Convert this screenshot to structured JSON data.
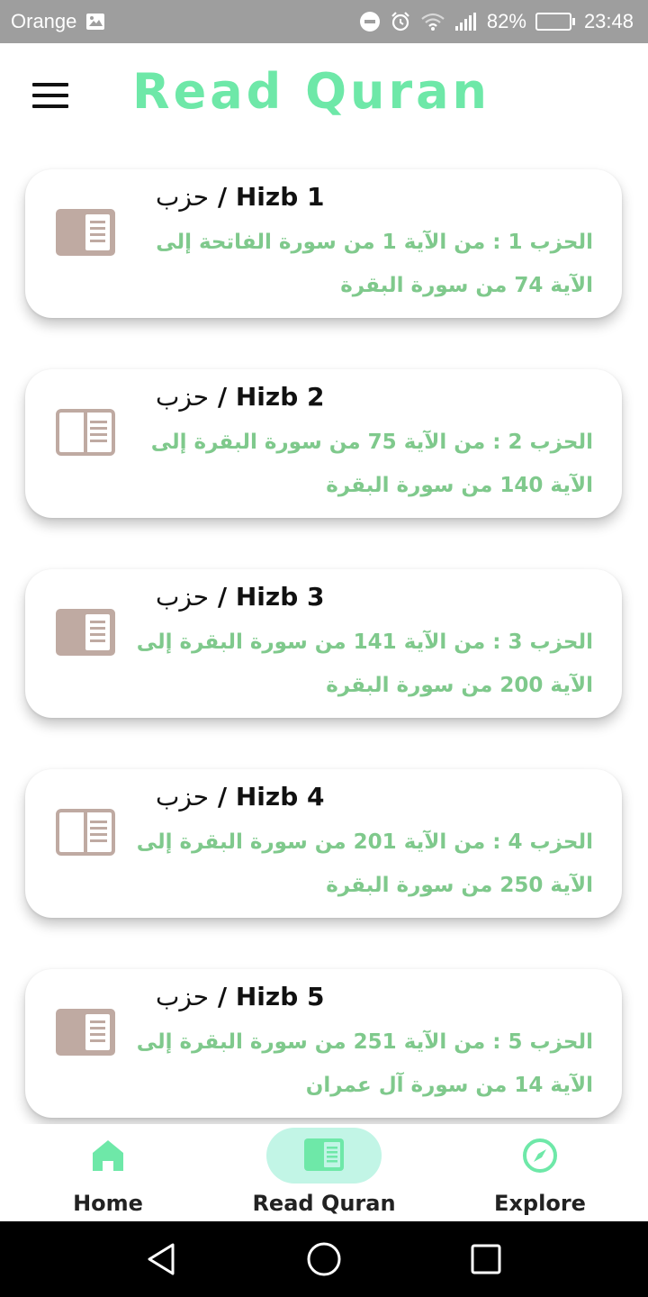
{
  "status_bar": {
    "carrier": "Orange",
    "battery": "82%",
    "battery_level": 0.82,
    "time": "23:48",
    "icons": [
      "image-icon",
      "do-not-disturb-icon",
      "alarm-icon",
      "wifi-icon",
      "signal-icon",
      "battery-icon"
    ]
  },
  "app_bar": {
    "title": "Read Quran",
    "menu_icon": "hamburger-menu-icon"
  },
  "colors": {
    "accent": "#6ee8a8",
    "subtitle": "#7fc98c",
    "icon": "#bfaaa2",
    "active_pill": "#c2f5e6",
    "status_bar": "#9e9e9e"
  },
  "hizb_list": [
    {
      "title_en": "Hizb 1",
      "title_sep": " / ",
      "title_ar": "حزب",
      "line1": "الحزب 1  : من الآية 1 من سورة الفاتحة إلى",
      "line2": "الآية 74 من سورة البقرة",
      "icon": "open-book-icon"
    },
    {
      "title_en": "Hizb 2",
      "title_sep": " / ",
      "title_ar": "حزب",
      "line1": "الحزب 2  : من الآية 75  من سورة البقرة إلى",
      "line2": "الآية 140 من سورة البقرة",
      "icon": "open-book-icon"
    },
    {
      "title_en": "Hizb 3",
      "title_sep": " / ",
      "title_ar": "حزب",
      "line1": "الحزب 3  : من الآية 141  من سورة البقرة إلى",
      "line2": "الآية 200 من سورة البقرة",
      "icon": "open-book-icon"
    },
    {
      "title_en": "Hizb 4",
      "title_sep": " / ",
      "title_ar": "حزب",
      "line1": "الحزب 4  : من الآية 201  من سورة البقرة إلى",
      "line2": "الآية 250 من سورة البقرة",
      "icon": "open-book-icon"
    },
    {
      "title_en": "Hizb 5",
      "title_sep": " / ",
      "title_ar": "حزب",
      "line1": "الحزب 5  : من الآية 251  من سورة البقرة إلى",
      "line2": "الآية 14 من سورة آل عمران",
      "icon": "open-book-icon"
    }
  ],
  "bottom_nav": {
    "items": [
      {
        "label": "Home",
        "icon": "home-icon",
        "active": false
      },
      {
        "label": "Read Quran",
        "icon": "book-icon",
        "active": true
      },
      {
        "label": "Explore",
        "icon": "compass-icon",
        "active": false
      }
    ]
  },
  "system_nav": {
    "icons": [
      "back-icon",
      "home-circle-icon",
      "recents-icon"
    ]
  }
}
